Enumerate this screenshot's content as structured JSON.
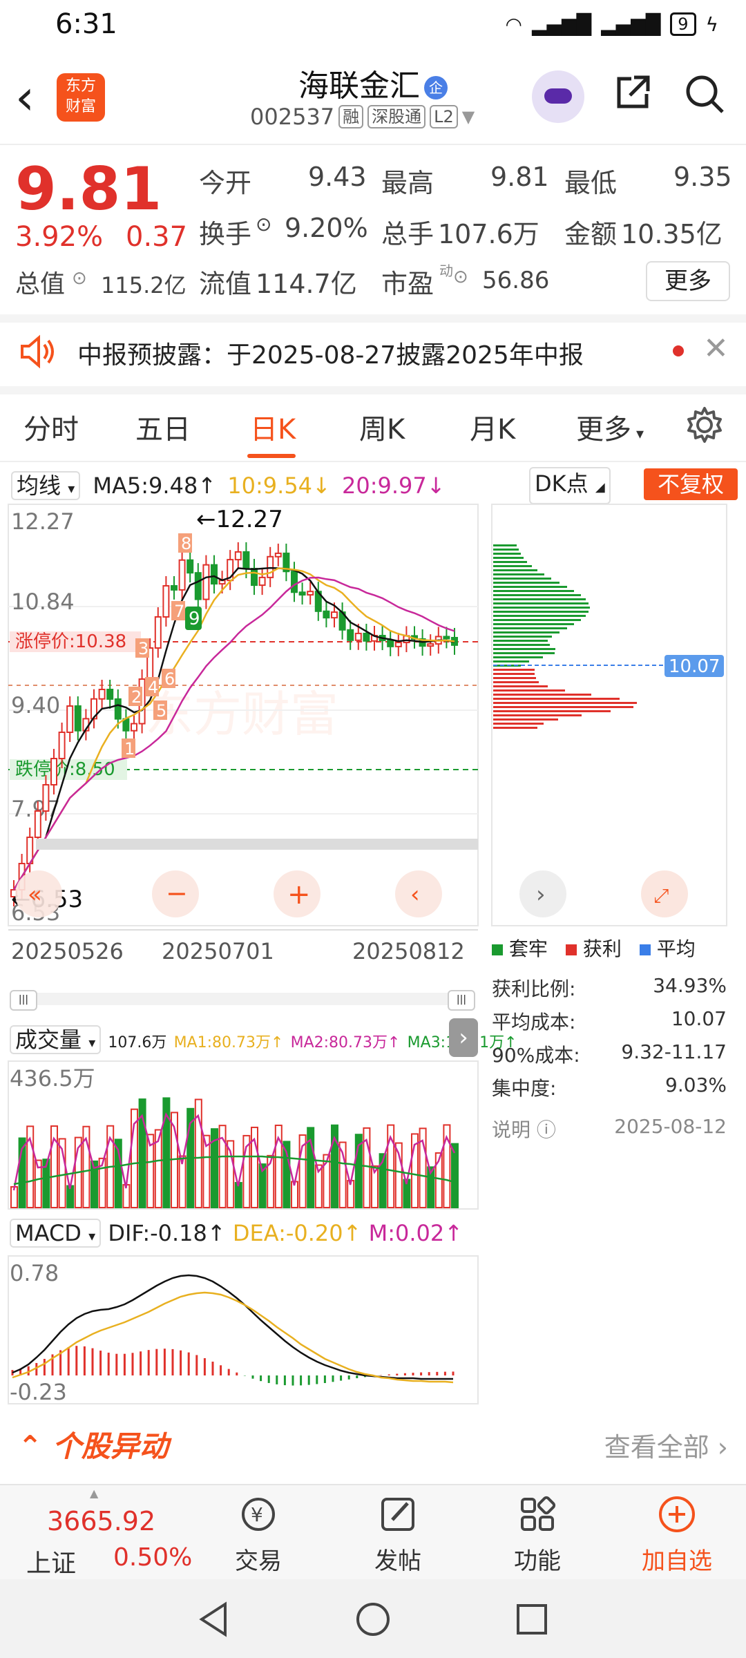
{
  "status_bar": {
    "time": "6:31",
    "signal1": "⁴ᴳ",
    "signal2": "⁴ᴳ",
    "battery": "9"
  },
  "header": {
    "logo_line1": "东方",
    "logo_line2": "财富",
    "stock_name": "海联金汇",
    "qi_badge": "企",
    "stock_code": "002537",
    "tags": [
      "融",
      "深股通",
      "L2"
    ]
  },
  "quote": {
    "price": "9.81",
    "change_pct": "3.92%",
    "change_amt": "0.37",
    "open_label": "今开",
    "open": "9.43",
    "high_label": "最高",
    "high": "9.81",
    "low_label": "最低",
    "low": "9.35",
    "turnover_label": "换手",
    "turnover": "9.20%",
    "volume_label": "总手",
    "volume": "107.6万",
    "amount_label": "金额",
    "amount": "10.35亿",
    "total_cap_label": "总值",
    "total_cap": "115.2亿",
    "float_cap_label": "流值",
    "float_cap": "114.7亿",
    "pe_label": "市盈",
    "pe_sup": "动",
    "pe": "56.86",
    "more": "更多"
  },
  "notice": {
    "text": "中报预披露：于2025-08-27披露2025年中报"
  },
  "tabs": [
    "分时",
    "五日",
    "日K",
    "周K",
    "月K",
    "更多"
  ],
  "kline": {
    "ma_selector": "均线",
    "ma5": "MA5:9.48",
    "ma10": "10:9.54",
    "ma20": "20:9.97",
    "dk_button": "DK点",
    "fuquan_button": "不复权",
    "y_labels": [
      "12.27",
      "10.84",
      "9.40",
      "7.97",
      "6.53"
    ],
    "high_marker": "←12.27",
    "low_marker": "←6.53",
    "limit_up": "涨停价:10.38",
    "limit_down": "跌停价:8.50",
    "watermark": "东方财富",
    "x_labels": [
      "20250526",
      "20250701",
      "20250812"
    ],
    "signals": [
      "1",
      "2",
      "3",
      "4",
      "5",
      "6",
      "7",
      "8",
      "9"
    ]
  },
  "chip": {
    "avg_tag": "10.07",
    "legend": [
      "套牢",
      "获利",
      "平均"
    ],
    "rows": [
      {
        "label": "获利比例:",
        "value": "34.93%"
      },
      {
        "label": "平均成本:",
        "value": "10.07"
      },
      {
        "label": "90%成本:",
        "value": "9.32-11.17"
      },
      {
        "label": "集中度:",
        "value": "9.03%"
      }
    ],
    "note_label": "说明",
    "note_date": "2025-08-12"
  },
  "volume": {
    "selector": "成交量",
    "total": "107.6万",
    "ma1": "MA1:80.73万",
    "ma2": "MA2:80.73万",
    "ma3": "MA3:155.1万",
    "max_label": "436.5万"
  },
  "macd": {
    "selector": "MACD",
    "dif": "DIF:-0.18",
    "dea": "DEA:-0.20",
    "m": "M:0.02",
    "top_label": "0.78",
    "bottom_label": "-0.23"
  },
  "movement": {
    "title": "个股异动",
    "view_all": "查看全部"
  },
  "bottom_nav": {
    "index_value": "3665.92",
    "index_name": "上证",
    "index_pct": "0.50%",
    "items": [
      "交易",
      "发帖",
      "功能",
      "加自选"
    ]
  },
  "colors": {
    "up": "#e0312b",
    "down": "#1a9a2f",
    "accent": "#f5521c"
  }
}
